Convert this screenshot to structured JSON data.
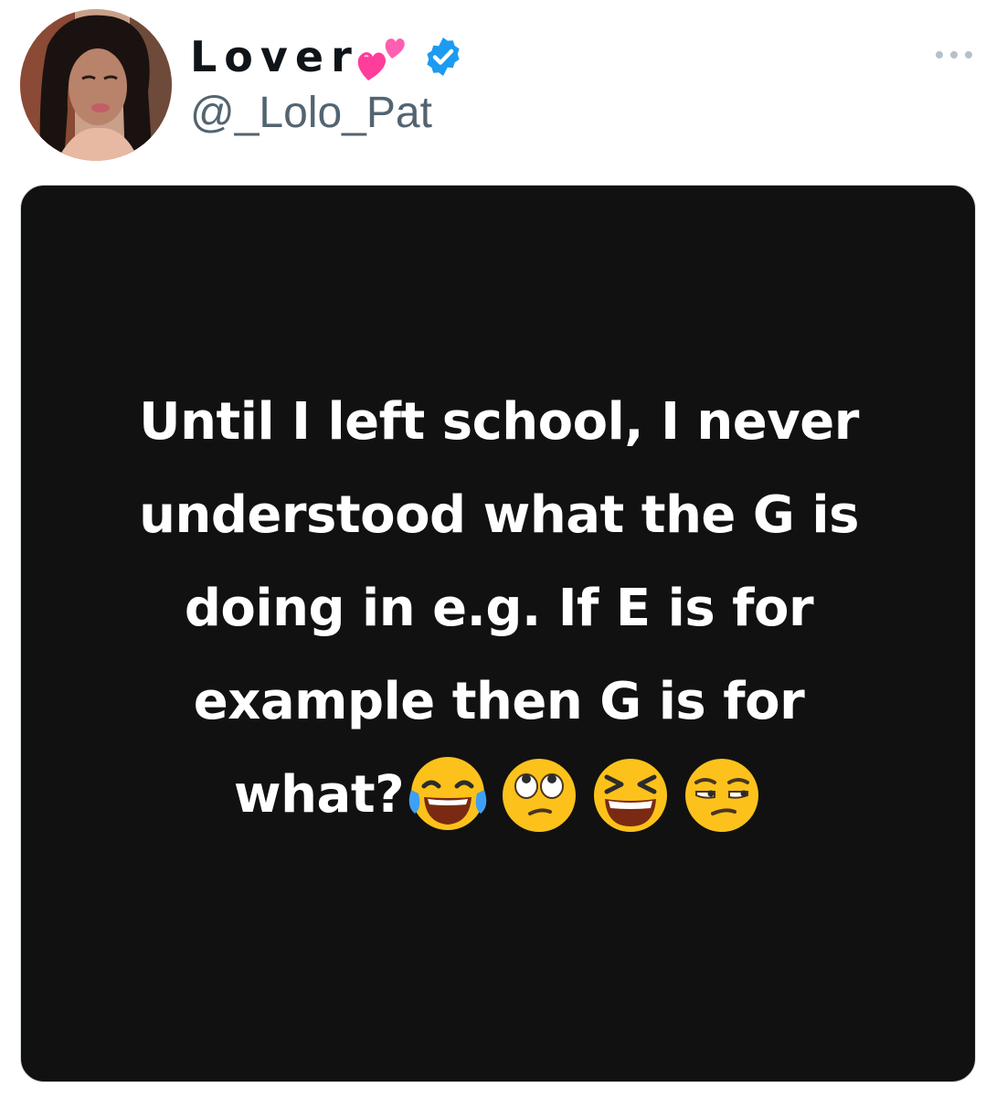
{
  "author": {
    "display_name": "Lover",
    "name_emoji": "two-hearts-emoji",
    "verified": true,
    "handle": "@_Lolo_Pat"
  },
  "media": {
    "lines": [
      "Until I left school, I never",
      "understood what the G is",
      "doing in e.g. If E is for",
      "example then G is for"
    ],
    "last_line": "what?",
    "emojis": [
      "face-with-tears-of-joy-emoji",
      "face-with-rolling-eyes-emoji",
      "grinning-squinting-face-emoji",
      "unamused-face-emoji"
    ]
  },
  "colors": {
    "verified_blue": "#1d9bf0",
    "handle_gray": "#536471",
    "media_background": "#111111",
    "heart_pink": "#ff4fa3"
  }
}
